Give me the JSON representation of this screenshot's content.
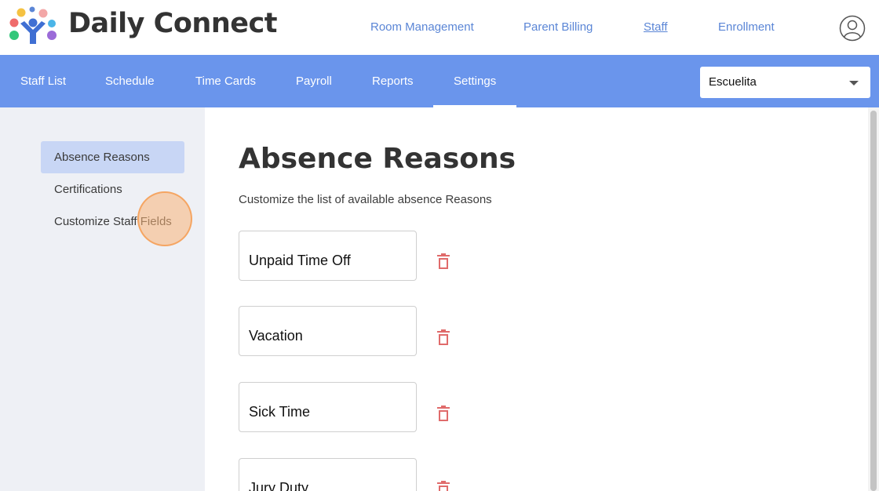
{
  "header": {
    "brand": "Daily Connect",
    "nav": [
      "Room Management",
      "Parent Billing",
      "Staff",
      "Enrollment"
    ],
    "active_nav": "Staff"
  },
  "subnav": {
    "items": [
      "Staff List",
      "Schedule",
      "Time Cards",
      "Payroll",
      "Reports",
      "Settings"
    ],
    "active": "Settings",
    "school": "Escuelita"
  },
  "sidebar": {
    "items": [
      "Absence Reasons",
      "Certifications",
      "Customize Staff Fields"
    ],
    "active": "Absence Reasons"
  },
  "main": {
    "title": "Absence Reasons",
    "description": "Customize the list of available absence Reasons",
    "reasons": [
      "Unpaid Time Off",
      "Vacation",
      "Sick Time",
      "Jury Duty"
    ]
  },
  "colors": {
    "accent": "#6a95ec",
    "link": "#5b86d6",
    "sidebar_bg": "#eef0f5",
    "sidebar_active": "#c8d6f5",
    "delete": "#e06b6b"
  },
  "icons": [
    "logo-icon",
    "user-profile-icon",
    "chevron-down-icon",
    "trash-icon"
  ]
}
